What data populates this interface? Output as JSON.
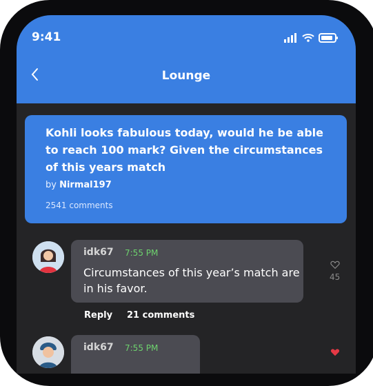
{
  "status": {
    "time": "9:41"
  },
  "header": {
    "title": "Lounge"
  },
  "post": {
    "title": "Kohli looks fabulous today, would he be able to reach 100 mark? Given the circumstances of this years match",
    "by_prefix": "by",
    "author": "Nirmal197",
    "comments": "2541 comments"
  },
  "comments": [
    {
      "user": "idk67",
      "time": "7:55 PM",
      "text": "Circumstances of this year’s match are in his favor.",
      "reply_label": "Reply",
      "comments_label": "21 comments",
      "likes": "45"
    },
    {
      "user": "idk67",
      "time": "7:55 PM"
    }
  ],
  "colors": {
    "header_blue": "#3a7fe2",
    "bubble_bg": "#4b4b52",
    "screen_bg": "#242426",
    "timestamp_green": "#6ed36e",
    "liked_red": "#e53945"
  }
}
